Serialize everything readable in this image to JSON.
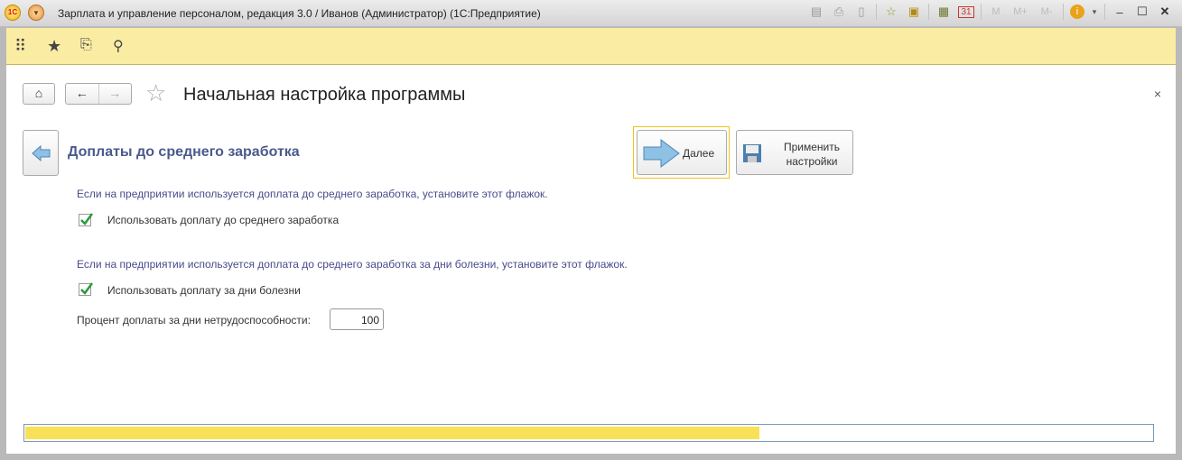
{
  "window": {
    "title": "Зарплата и управление персоналом, редакция 3.0 / Иванов (Администратор)  (1С:Предприятие)",
    "logo": "1С",
    "toolbar_icons": [
      "save-icon",
      "print-icon",
      "preview-icon",
      "add-favorite-icon",
      "favorites-icon",
      "calculator-icon",
      "calendar-icon",
      "M",
      "M+",
      "M-",
      "info-icon",
      "minimize-icon",
      "maximize-icon",
      "close-icon"
    ],
    "calendar_day": "31",
    "mem": [
      "M",
      "M+",
      "M-"
    ]
  },
  "page": {
    "title": "Начальная настройка программы",
    "close": "×"
  },
  "section": {
    "title": "Доплаты до среднего заработка"
  },
  "buttons": {
    "next": "Далее",
    "apply": "Применить настройки"
  },
  "form": {
    "hint1": "Если на предприятии используется доплата до среднего заработка, установите этот флажок.",
    "check1": {
      "label": "Использовать доплату до среднего заработка",
      "checked": true
    },
    "hint2": "Если на предприятии используется доплата до среднего заработка за дни болезни, установите этот флажок.",
    "check2": {
      "label": "Использовать доплату за дни болезни",
      "checked": true
    },
    "percent_label": "Процент доплаты за дни нетрудоспособности:",
    "percent_value": "100"
  },
  "progress": {
    "percent": 65
  },
  "colors": {
    "accent": "#f9e157",
    "section_title": "#4a5a8c",
    "hint": "#4a4a8c"
  }
}
